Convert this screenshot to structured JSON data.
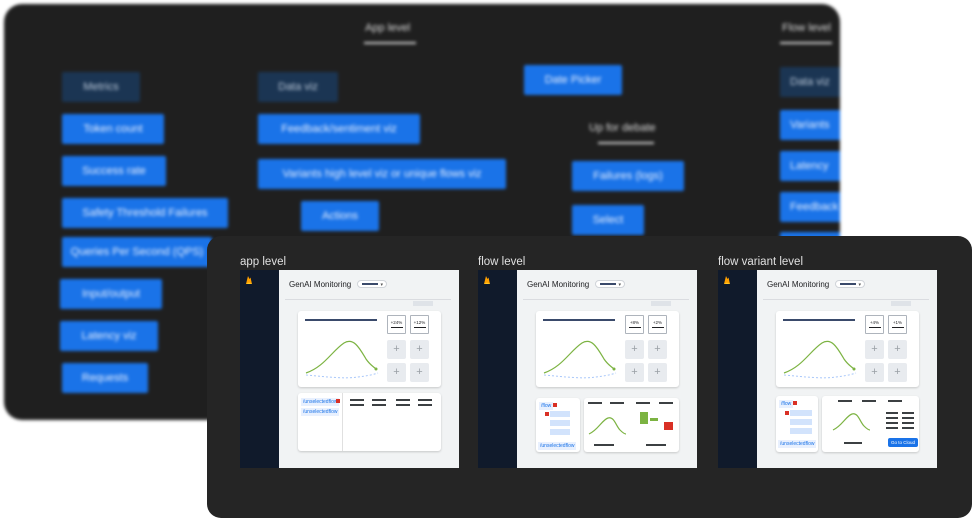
{
  "board_back": {
    "headings": {
      "app_level": "App level",
      "flow_level": "Flow level",
      "up_for_debate": "Up for debate"
    },
    "col1": [
      "Metrics",
      "Token count",
      "Success rate",
      "Safety Threshold Failures",
      "Queries Per Second (QPS)",
      "Input/output",
      "Latency viz",
      "Requests"
    ],
    "col2": [
      "Data viz",
      "Feedback/sentiment viz",
      "Variants high level viz or unique flows viz",
      "Actions"
    ],
    "col3": [
      "Date Picker",
      "Failures (logs)",
      "Select"
    ],
    "col4": [
      "Data viz",
      "Variants",
      "Latency",
      "Feedback",
      ""
    ]
  },
  "panels": [
    {
      "title": "app level",
      "app_name": "GenAI Monitoring",
      "kpis": [
        "+24%",
        "+12%"
      ],
      "list_tags": [
        "/unselectedflow",
        "/unselectedflow"
      ]
    },
    {
      "title": "flow level",
      "app_name": "GenAI Monitoring",
      "kpis": [
        "+8%",
        "+2%"
      ],
      "list_tags": [
        "/flow",
        "/unselectedflow"
      ]
    },
    {
      "title": "flow variant level",
      "app_name": "GenAI Monitoring",
      "kpis": [
        "+4%",
        "+1%"
      ],
      "list_tags": [
        "/flow",
        "/unselectedflow"
      ],
      "button": "Go to Cloud"
    }
  ],
  "icons": {
    "logo": "firebase-flame-icon",
    "add": "plus-icon",
    "dropdown": "chevron-down-icon"
  },
  "colors": {
    "board": "#1f1f1f",
    "chip_blue": "#1a73e8",
    "chip_dark": "#1b3553",
    "line_green": "#7cb342",
    "line_dashed": "#a8c7fa",
    "alert_red": "#d93025"
  }
}
